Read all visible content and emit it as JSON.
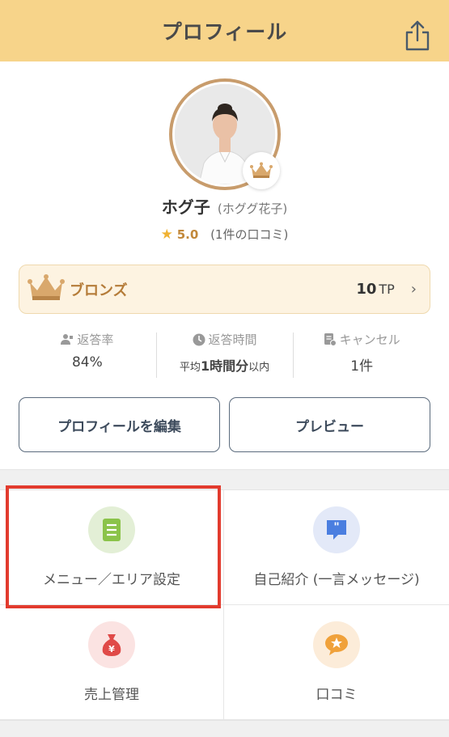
{
  "header": {
    "title": "プロフィール"
  },
  "profile": {
    "name": "ホグ子",
    "real_name": "(ホググ花子)",
    "rating": "5.0",
    "reviews": "(1件の口コミ)"
  },
  "rank": {
    "label": "ブロンズ",
    "points": "10",
    "unit": "TP",
    "chevron": "›"
  },
  "stats": [
    {
      "label": "返答率",
      "value": "84%"
    },
    {
      "label": "返答時間",
      "value_prefix": "平均",
      "value_main": "1時間分",
      "value_suffix": "以内"
    },
    {
      "label": "キャンセル",
      "value": "1件"
    }
  ],
  "buttons": {
    "edit": "プロフィールを編集",
    "preview": "プレビュー"
  },
  "menu": [
    {
      "label": "メニュー／エリア設定",
      "icon": "document-icon",
      "color": "#e3efd6"
    },
    {
      "label": "自己紹介 (一言メッセージ)",
      "icon": "speech-bubble-icon",
      "color": "#e3e9f8"
    },
    {
      "label": "売上管理",
      "icon": "money-bag-icon",
      "color": "#fbe3e2"
    },
    {
      "label": "口コミ",
      "icon": "star-bubble-icon",
      "color": "#fcecd9"
    }
  ],
  "colors": {
    "header_bg": "#f7d48a",
    "rank_text": "#b57c39",
    "highlight": "#e23b2e"
  }
}
